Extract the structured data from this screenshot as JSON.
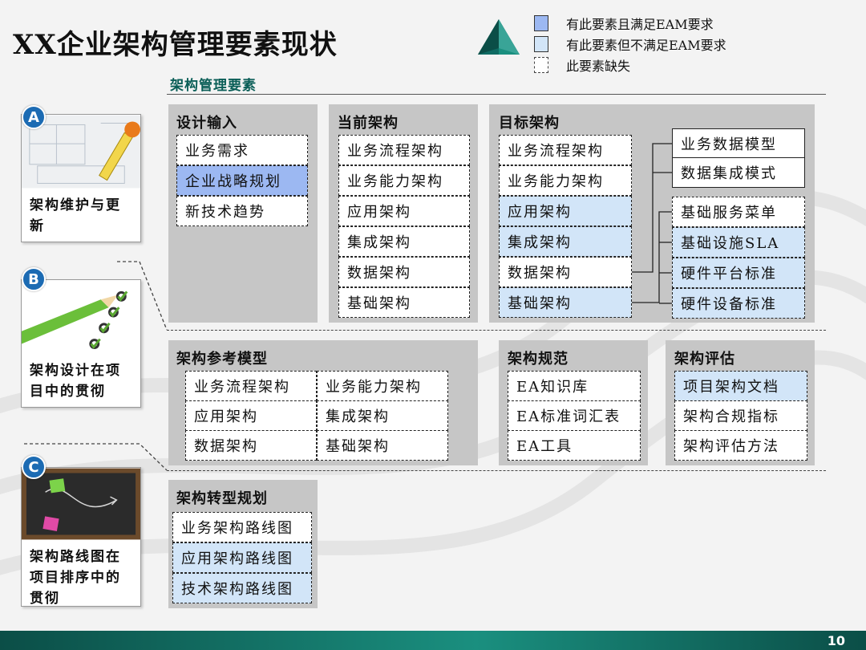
{
  "title": "XX企业架构管理要素现状",
  "page_number": "10",
  "colors": {
    "dark_fill": "#9cb8f2",
    "light_fill": "#d2e5f8",
    "panel_bg": "#c6c6c6",
    "accent_teal": "#0a5e57",
    "badge_blue": "#1c6bb3"
  },
  "legend": [
    {
      "label": "有此要素且满足EAM要求",
      "kind": "dark"
    },
    {
      "label": "有此要素但不满足EAM要求",
      "kind": "light"
    },
    {
      "label": "此要素缺失",
      "kind": "missing"
    }
  ],
  "section_label": "架构管理要素",
  "panels": {
    "design_input": {
      "title": "设计输入",
      "items": [
        {
          "label": "业务需求",
          "status": "missing"
        },
        {
          "label": "企业战略规划",
          "status": "dark"
        },
        {
          "label": "新技术趋势",
          "status": "missing"
        }
      ]
    },
    "current_arch": {
      "title": "当前架构",
      "items": [
        {
          "label": "业务流程架构",
          "status": "missing"
        },
        {
          "label": "业务能力架构",
          "status": "missing"
        },
        {
          "label": "应用架构",
          "status": "missing"
        },
        {
          "label": "集成架构",
          "status": "missing"
        },
        {
          "label": "数据架构",
          "status": "missing"
        },
        {
          "label": "基础架构",
          "status": "missing"
        }
      ]
    },
    "target_arch": {
      "title": "目标架构",
      "items": [
        {
          "label": "业务流程架构",
          "status": "missing"
        },
        {
          "label": "业务能力架构",
          "status": "missing"
        },
        {
          "label": "应用架构",
          "status": "light"
        },
        {
          "label": "集成架构",
          "status": "light"
        },
        {
          "label": "数据架构",
          "status": "missing"
        },
        {
          "label": "基础架构",
          "status": "light"
        }
      ],
      "data_subitems": [
        {
          "label": "业务数据模型",
          "status": "complete"
        },
        {
          "label": "数据集成模式",
          "status": "complete"
        }
      ],
      "infra_subitems": [
        {
          "label": "基础服务菜单",
          "status": "missing"
        },
        {
          "label": "基础设施SLA",
          "status": "light"
        },
        {
          "label": "硬件平台标准",
          "status": "light"
        },
        {
          "label": "硬件设备标准",
          "status": "light"
        }
      ]
    },
    "reference_model": {
      "title": "架构参考模型",
      "items": [
        {
          "label": "业务流程架构",
          "status": "missing"
        },
        {
          "label": "业务能力架构",
          "status": "missing"
        },
        {
          "label": "应用架构",
          "status": "missing"
        },
        {
          "label": "集成架构",
          "status": "missing"
        },
        {
          "label": "数据架构",
          "status": "missing"
        },
        {
          "label": "基础架构",
          "status": "missing"
        }
      ]
    },
    "arch_standard": {
      "title": "架构规范",
      "items": [
        {
          "label": "EA知识库",
          "status": "missing"
        },
        {
          "label": "EA标准词汇表",
          "status": "missing"
        },
        {
          "label": "EA工具",
          "status": "missing"
        }
      ]
    },
    "arch_assessment": {
      "title": "架构评估",
      "items": [
        {
          "label": "项目架构文档",
          "status": "light"
        },
        {
          "label": "架构合规指标",
          "status": "missing"
        },
        {
          "label": "架构评估方法",
          "status": "missing"
        }
      ]
    },
    "transition_plan": {
      "title": "架构转型规划",
      "items": [
        {
          "label": "业务架构路线图",
          "status": "missing"
        },
        {
          "label": "应用架构路线图",
          "status": "light"
        },
        {
          "label": "技术架构路线图",
          "status": "light"
        }
      ]
    }
  },
  "side_cards": [
    {
      "badge": "A",
      "text": "架构维护与更新",
      "icon": "blueprint-tape-measure-image"
    },
    {
      "badge": "B",
      "text": "架构设计在项目中的贯彻",
      "icon": "pencil-checklist-image"
    },
    {
      "badge": "C",
      "text": "架构路线图在项目排序中的贯彻",
      "icon": "chalkboard-sticky-notes-image"
    }
  ]
}
